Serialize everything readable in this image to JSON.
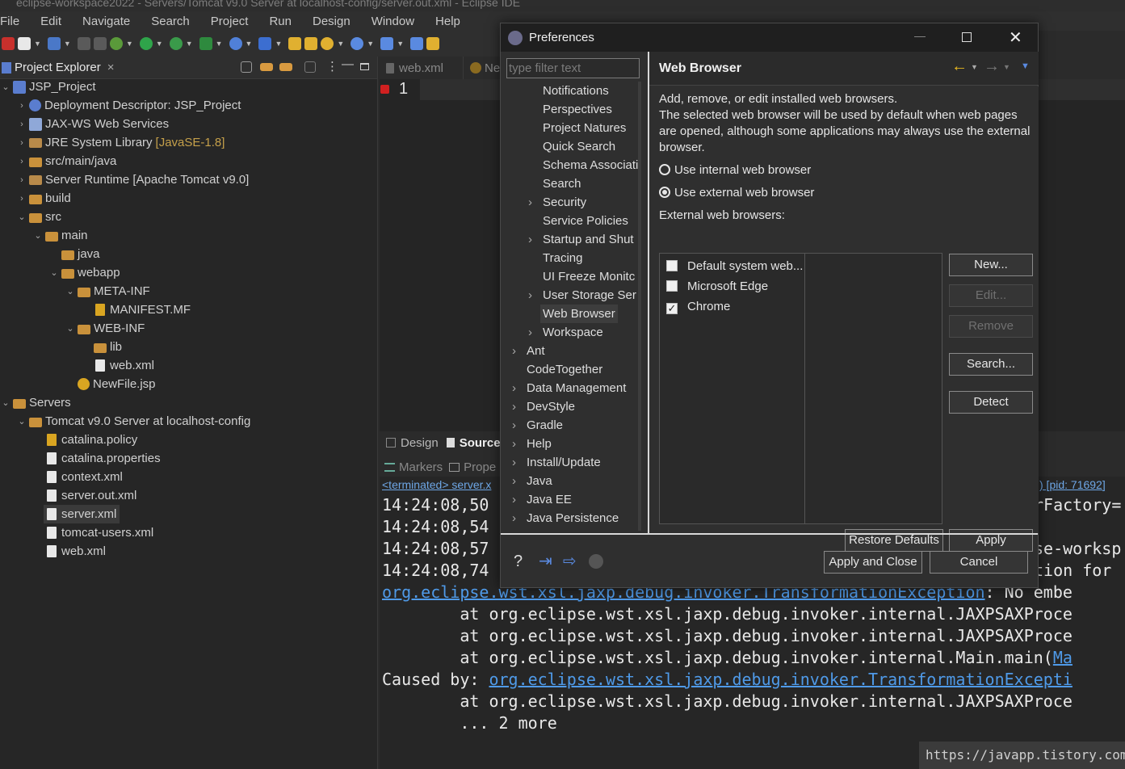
{
  "window": {
    "title": "eclipse-workspace2022 - Servers/Tomcat v9.0 Server at localhost-config/server.out.xml - Eclipse IDE"
  },
  "menu": [
    "File",
    "Edit",
    "Navigate",
    "Search",
    "Project",
    "Run",
    "Design",
    "Window",
    "Help"
  ],
  "explorer": {
    "title": "Project Explorer",
    "close": "×",
    "rows": [
      {
        "label": "JSP_Project"
      },
      {
        "label": "Deployment Descriptor: JSP_Project"
      },
      {
        "label": "JAX-WS Web Services"
      },
      {
        "label": "JRE System Library",
        "suffix": "[JavaSE-1.8]"
      },
      {
        "label": "src/main/java"
      },
      {
        "label": "Server Runtime [Apache Tomcat v9.0]"
      },
      {
        "label": "build"
      },
      {
        "label": "src"
      },
      {
        "label": "main"
      },
      {
        "label": "java"
      },
      {
        "label": "webapp"
      },
      {
        "label": "META-INF"
      },
      {
        "label": "MANIFEST.MF"
      },
      {
        "label": "WEB-INF"
      },
      {
        "label": "lib"
      },
      {
        "label": "web.xml"
      },
      {
        "label": "NewFile.jsp"
      },
      {
        "label": "Servers"
      },
      {
        "label": "Tomcat v9.0 Server at localhost-config"
      },
      {
        "label": "catalina.policy"
      },
      {
        "label": "catalina.properties"
      },
      {
        "label": "context.xml"
      },
      {
        "label": "server.out.xml"
      },
      {
        "label": "server.xml"
      },
      {
        "label": "tomcat-users.xml"
      },
      {
        "label": "web.xml"
      }
    ]
  },
  "editor": {
    "tabs": [
      "web.xml",
      "Ne"
    ],
    "line_number": "1",
    "bottom_tabs": [
      "Design",
      "Source"
    ]
  },
  "console": {
    "tabs": [
      "Markers",
      "Prope"
    ],
    "status_left": "<terminated> server.x",
    "status_right": ") [pid: 71692]",
    "lines": [
      {
        "text": "14:24:08,50",
        "tail": "rFactory="
      },
      {
        "text": "14:24:08,54",
        "tail": ""
      },
      {
        "text": "14:24:08,57",
        "tail": "se-worksp"
      },
      {
        "text": "14:24:08,74",
        "tail": "tion for "
      },
      {
        "link": "org.eclipse.wst.xsl.jaxp.debug.invoker.TransformationException",
        "tail": ": No embe"
      },
      {
        "text": "        at org.eclipse.wst.xsl.jaxp.debug.invoker.internal.JAXPSAXProce"
      },
      {
        "text": "        at org.eclipse.wst.xsl.jaxp.debug.invoker.internal.JAXPSAXProce"
      },
      {
        "text": "        at org.eclipse.wst.xsl.jaxp.debug.invoker.internal.Main.main(",
        "link2": "Ma"
      },
      {
        "text": "Caused by: ",
        "link": "org.eclipse.wst.xsl.jaxp.debug.invoker.TransformationExcepti"
      },
      {
        "text": "        at org.eclipse.wst.xsl.jaxp.debug.invoker.internal.JAXPSAXProce"
      },
      {
        "text": "        ... 2 more"
      }
    ]
  },
  "watermark": "https://javapp.tistory.com/",
  "dialog": {
    "title": "Preferences",
    "filter_placeholder": "type filter text",
    "nav": [
      {
        "label": "Notifications"
      },
      {
        "label": "Perspectives"
      },
      {
        "label": "Project Natures"
      },
      {
        "label": "Quick Search"
      },
      {
        "label": "Schema Associati"
      },
      {
        "label": "Search"
      },
      {
        "label": "Security"
      },
      {
        "label": "Service Policies"
      },
      {
        "label": "Startup and Shut"
      },
      {
        "label": "Tracing"
      },
      {
        "label": "UI Freeze Monitc"
      },
      {
        "label": "User Storage Ser"
      },
      {
        "label": "Web Browser"
      },
      {
        "label": "Workspace"
      },
      {
        "label": "Ant"
      },
      {
        "label": "CodeTogether"
      },
      {
        "label": "Data Management"
      },
      {
        "label": "DevStyle"
      },
      {
        "label": "Gradle"
      },
      {
        "label": "Help"
      },
      {
        "label": "Install/Update"
      },
      {
        "label": "Java"
      },
      {
        "label": "Java EE"
      },
      {
        "label": "Java Persistence"
      }
    ],
    "page": {
      "title": "Web Browser",
      "description": "Add, remove, or edit installed web browsers.\nThe selected web browser will be used by default when web pages are opened, although some applications may always use the external browser.",
      "radio_internal": "Use internal web browser",
      "radio_external": "Use external web browser",
      "list_label": "External web browsers:",
      "browsers": [
        {
          "name": "Default system web...",
          "checked": false
        },
        {
          "name": "Microsoft Edge",
          "checked": false
        },
        {
          "name": "Chrome",
          "checked": true
        }
      ],
      "buttons": {
        "new": "New...",
        "edit": "Edit...",
        "remove": "Remove",
        "search": "Search...",
        "detect": "Detect"
      },
      "restore_defaults": "Restore Defaults",
      "apply": "Apply"
    },
    "footer": {
      "apply_close": "Apply and Close",
      "cancel": "Cancel"
    }
  }
}
